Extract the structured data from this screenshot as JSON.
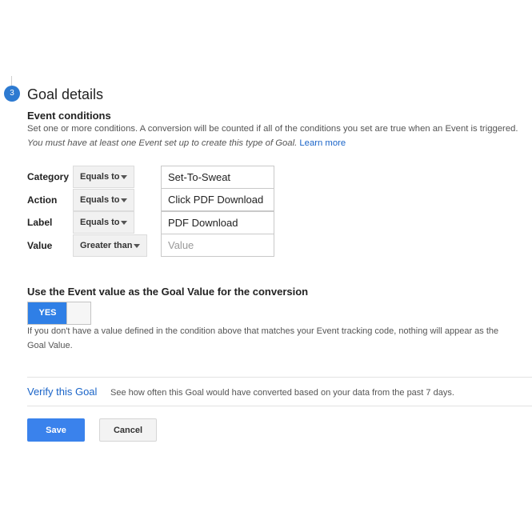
{
  "step": {
    "number": "3",
    "title": "Goal details"
  },
  "event_conditions": {
    "title": "Event conditions",
    "description_plain": "Set one or more conditions. A conversion will be counted if all of the conditions you set are true when an Event is triggered. ",
    "description_italic": "You must have at least one Event set up to create this type of Goal.",
    "learn_more": "Learn more",
    "rows": [
      {
        "label": "Category",
        "operator": "Equals to",
        "value": "Set-To-Sweat",
        "placeholder": ""
      },
      {
        "label": "Action",
        "operator": "Equals to",
        "value": "Click PDF Download",
        "placeholder": ""
      },
      {
        "label": "Label",
        "operator": "Equals to",
        "value": "PDF Download",
        "placeholder": ""
      },
      {
        "label": "Value",
        "operator": "Greater than",
        "value": "",
        "placeholder": "Value"
      }
    ]
  },
  "goal_value": {
    "title": "Use the Event value as the Goal Value for the conversion",
    "toggle_label": "YES",
    "note": "If you don't have a value defined in the condition above that matches your Event tracking code, nothing will appear as the Goal Value."
  },
  "verify": {
    "link": "Verify this Goal",
    "description": "See how often this Goal would have converted based on your data from the past 7 days."
  },
  "actions": {
    "save": "Save",
    "cancel": "Cancel"
  },
  "colors": {
    "accent": "#2f7fe6",
    "link": "#1a64c8",
    "step_circle": "#2d7ad1"
  }
}
